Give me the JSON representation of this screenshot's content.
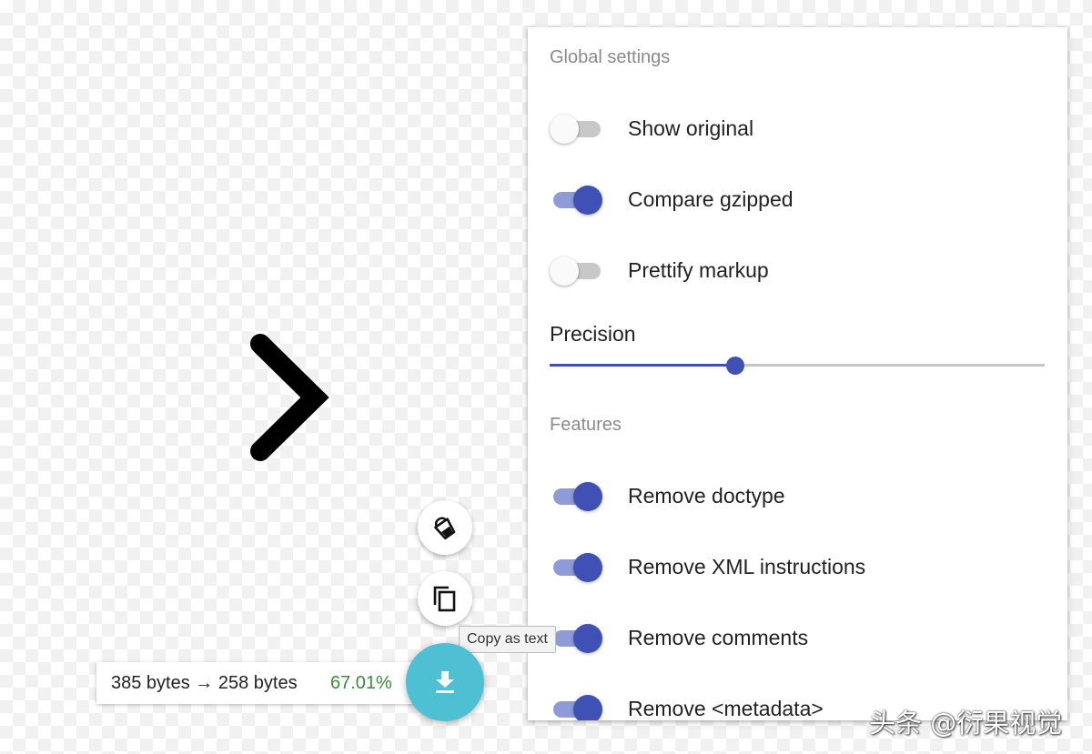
{
  "preview": {
    "icon": "chevron-right-icon"
  },
  "settings": {
    "global_title": "Global settings",
    "global_toggles": [
      {
        "label": "Show original",
        "checked": false
      },
      {
        "label": "Compare gzipped",
        "checked": true
      },
      {
        "label": "Prettify markup",
        "checked": false
      }
    ],
    "precision": {
      "label": "Precision",
      "fraction": 0.375
    },
    "features_title": "Features",
    "feature_toggles": [
      {
        "label": "Remove doctype",
        "checked": true
      },
      {
        "label": "Remove XML instructions",
        "checked": true
      },
      {
        "label": "Remove comments",
        "checked": true
      },
      {
        "label": "Remove <metadata>",
        "checked": true
      }
    ]
  },
  "actions": {
    "background_icon": "paint-bucket-icon",
    "copy_icon": "copy-icon",
    "download_icon": "download-icon",
    "copy_tooltip": "Copy as text"
  },
  "results": {
    "sizes": "385 bytes → 258 bytes",
    "percent": "67.01%"
  },
  "watermark": "头条 @衍果视觉",
  "colors": {
    "accent": "#3f51b5",
    "download_fab": "#4fbfd3",
    "percent_green": "#3c8b3c"
  }
}
